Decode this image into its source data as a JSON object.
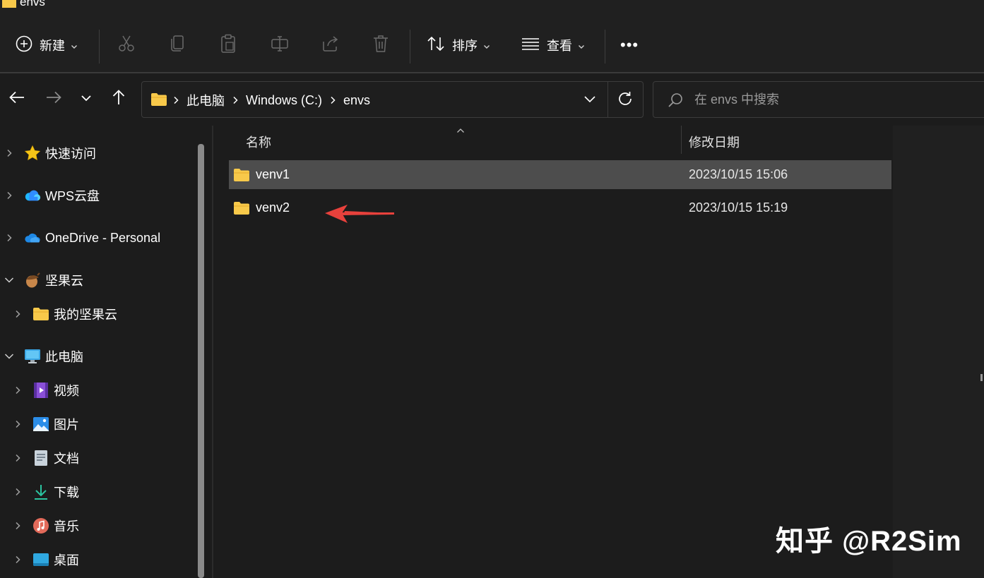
{
  "window": {
    "title": "envs"
  },
  "toolbar": {
    "new_label": "新建",
    "sort_label": "排序",
    "view_label": "查看",
    "more_label": "•••"
  },
  "address": {
    "crumbs": [
      "此电脑",
      "Windows (C:)",
      "envs"
    ]
  },
  "search": {
    "placeholder": "在 envs 中搜索"
  },
  "sidebar": {
    "items": [
      {
        "label": "快速访问",
        "icon": "star-icon"
      },
      {
        "label": "WPS云盘",
        "icon": "wps-cloud-icon"
      },
      {
        "label": "OneDrive - Personal",
        "icon": "onedrive-cloud-icon"
      },
      {
        "label": "坚果云",
        "icon": "nut-icon"
      },
      {
        "label": "我的坚果云",
        "icon": "folder-icon"
      },
      {
        "label": "此电脑",
        "icon": "computer-icon"
      },
      {
        "label": "视频",
        "icon": "video-icon"
      },
      {
        "label": "图片",
        "icon": "pictures-icon"
      },
      {
        "label": "文档",
        "icon": "document-icon"
      },
      {
        "label": "下载",
        "icon": "download-icon"
      },
      {
        "label": "音乐",
        "icon": "music-icon"
      },
      {
        "label": "桌面",
        "icon": "desktop-icon"
      }
    ]
  },
  "columns": {
    "name": "名称",
    "modified": "修改日期"
  },
  "files": [
    {
      "name": "venv1",
      "modified": "2023/10/15 15:06",
      "selected": true
    },
    {
      "name": "venv2",
      "modified": "2023/10/15 15:19",
      "selected": false
    }
  ],
  "watermark": "知乎 @R2Sim",
  "colors": {
    "background": "#1c1c1c",
    "selection": "#4d4d4d",
    "folder": "#f8c94a",
    "annotation_arrow": "#e8413c"
  }
}
